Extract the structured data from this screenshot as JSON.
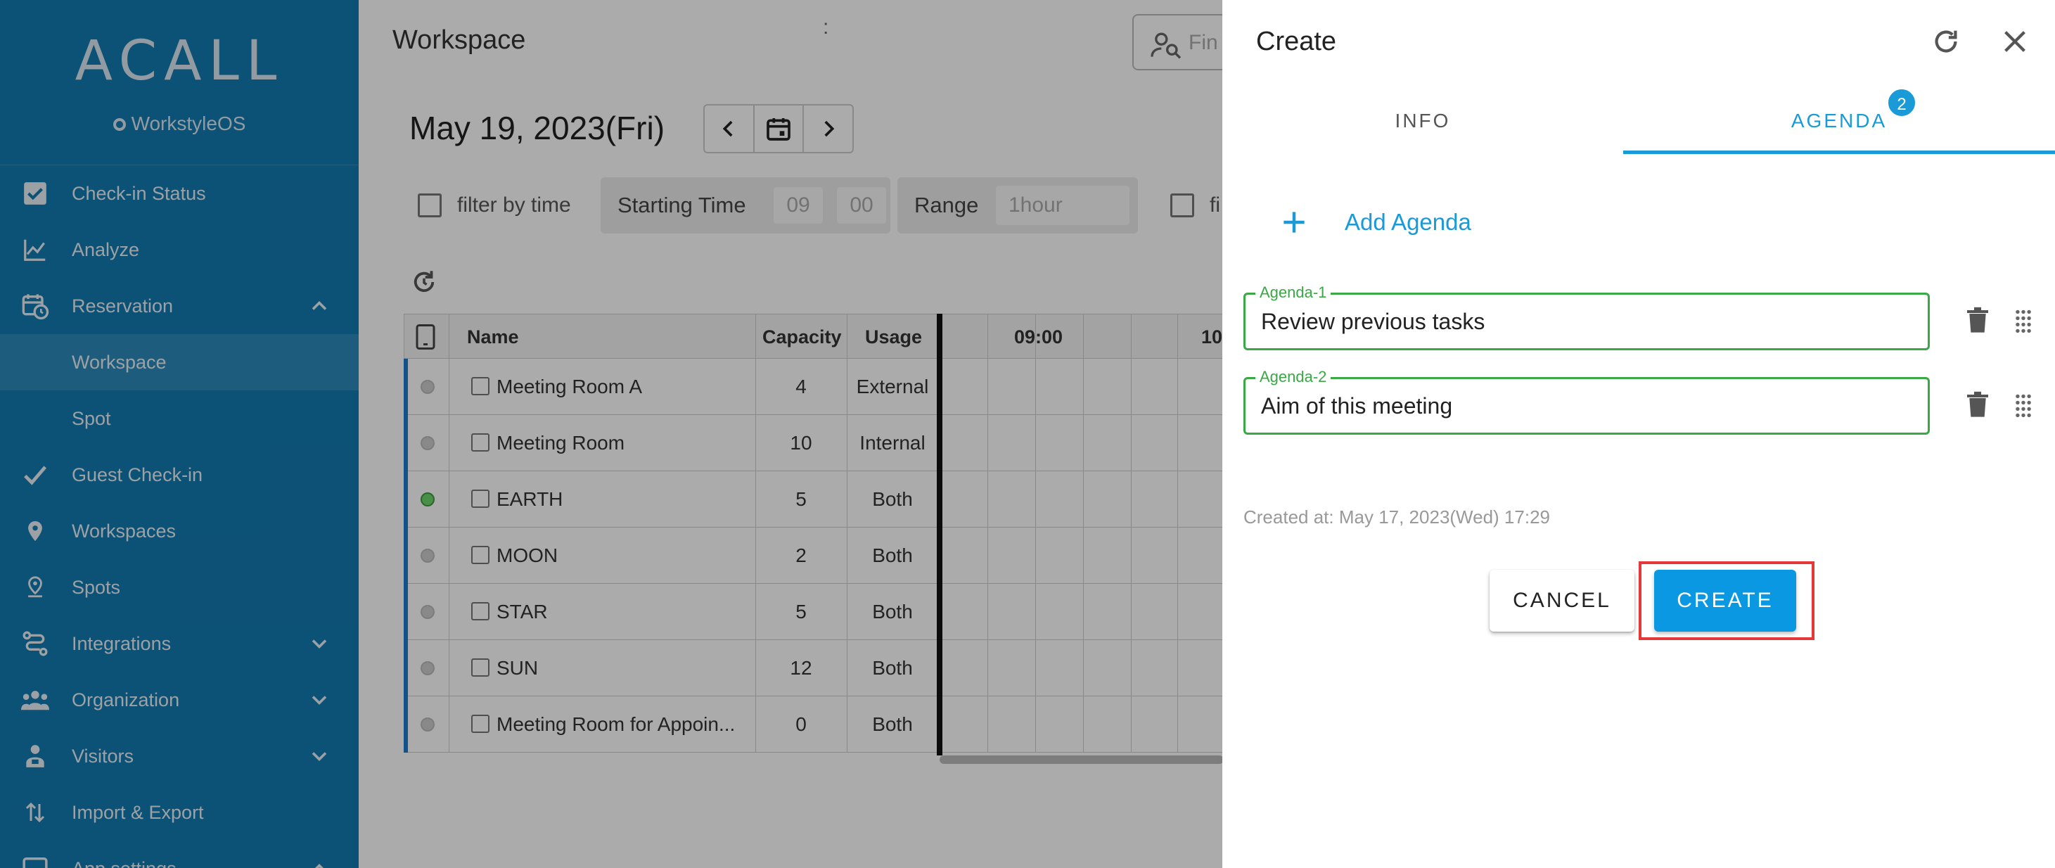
{
  "colors": {
    "sidebar": "#137ab0",
    "accent": "#1a9ad6",
    "field_border": "#3aa844",
    "highlight": "#e53838"
  },
  "sidebar": {
    "logo": "ACALL",
    "sublogo": "WorkstyleOS",
    "items": [
      {
        "label": "Check-in Status",
        "icon": "checkbox-icon"
      },
      {
        "label": "Analyze",
        "icon": "line-chart-icon"
      },
      {
        "label": "Reservation",
        "icon": "calendar-clock-icon",
        "expanded": true
      },
      {
        "label": "Workspace",
        "active": true
      },
      {
        "label": "Spot"
      },
      {
        "label": "Guest Check-in",
        "icon": "check-icon"
      },
      {
        "label": "Workspaces",
        "icon": "map-pin-icon"
      },
      {
        "label": "Spots",
        "icon": "pin-icon"
      },
      {
        "label": "Integrations",
        "icon": "integrations-icon",
        "expandable": true
      },
      {
        "label": "Organization",
        "icon": "people-icon",
        "expandable": true
      },
      {
        "label": "Visitors",
        "icon": "visitor-icon",
        "expandable": true
      },
      {
        "label": "Import & Export",
        "icon": "import-export-icon"
      },
      {
        "label": "App settings",
        "icon": "app-settings-icon",
        "expandable": true
      }
    ]
  },
  "main": {
    "title": "Workspace",
    "search_placeholder": "Fin",
    "date": "May 19, 2023(Fri)",
    "filter_by_time": "filter by time",
    "starting_time_label": "Starting Time",
    "start_hour": "09",
    "start_minute": "00",
    "range_label": "Range",
    "range_value": "1hour",
    "second_filter_label": "fi",
    "table": {
      "headers": {
        "name": "Name",
        "capacity": "Capacity",
        "usage": "Usage",
        "t1": "09:00",
        "t2": "10"
      },
      "rows": [
        {
          "name": "Meeting Room A",
          "capacity": "4",
          "usage": "External",
          "available": false
        },
        {
          "name": "Meeting Room",
          "capacity": "10",
          "usage": "Internal",
          "available": false
        },
        {
          "name": "EARTH",
          "capacity": "5",
          "usage": "Both",
          "available": true
        },
        {
          "name": "MOON",
          "capacity": "2",
          "usage": "Both",
          "available": false
        },
        {
          "name": "STAR",
          "capacity": "5",
          "usage": "Both",
          "available": false
        },
        {
          "name": "SUN",
          "capacity": "12",
          "usage": "Both",
          "available": false
        },
        {
          "name": "Meeting Room for Appoin...",
          "capacity": "0",
          "usage": "Both",
          "available": false
        }
      ]
    }
  },
  "dialog": {
    "title": "Create",
    "tabs": {
      "info": "INFO",
      "agenda": "AGENDA",
      "agenda_badge": "2"
    },
    "add_agenda": "Add Agenda",
    "agendas": [
      {
        "label": "Agenda-1",
        "value": "Review previous tasks"
      },
      {
        "label": "Agenda-2",
        "value": "Aim of this meeting"
      }
    ],
    "created_at": "Created at: May 17, 2023(Wed) 17:29",
    "cancel": "CANCEL",
    "create": "CREATE"
  }
}
